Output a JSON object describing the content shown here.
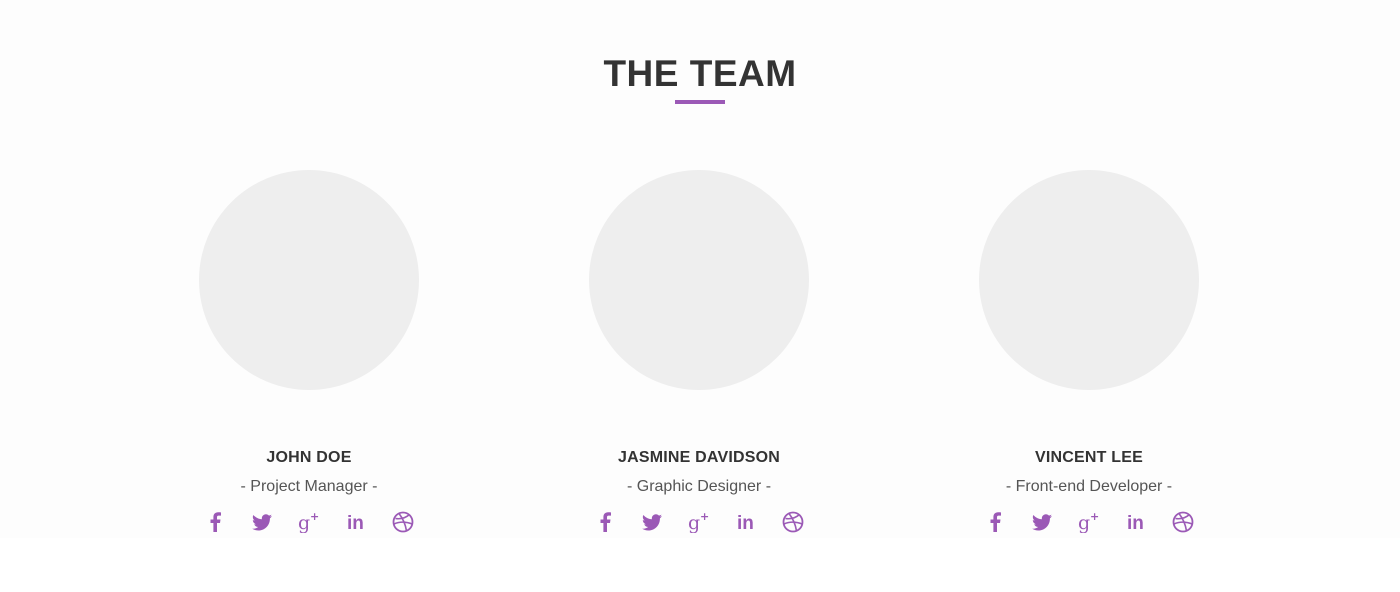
{
  "section": {
    "title": "THE TEAM",
    "accent_color": "#9b59b6"
  },
  "members": [
    {
      "name": "JOHN DOE",
      "role": "- Project Manager -",
      "socials": [
        "facebook-icon",
        "twitter-icon",
        "google-plus-icon",
        "linkedin-icon",
        "dribbble-icon"
      ]
    },
    {
      "name": "JASMINE DAVIDSON",
      "role": "- Graphic Designer -",
      "socials": [
        "facebook-icon",
        "twitter-icon",
        "google-plus-icon",
        "linkedin-icon",
        "dribbble-icon"
      ]
    },
    {
      "name": "VINCENT LEE",
      "role": "- Front-end Developer -",
      "socials": [
        "facebook-icon",
        "twitter-icon",
        "google-plus-icon",
        "linkedin-icon",
        "dribbble-icon"
      ]
    }
  ],
  "colors": {
    "avatar_placeholder": "#eeeeee",
    "icon": "#9b59b6",
    "heading": "#333333"
  }
}
